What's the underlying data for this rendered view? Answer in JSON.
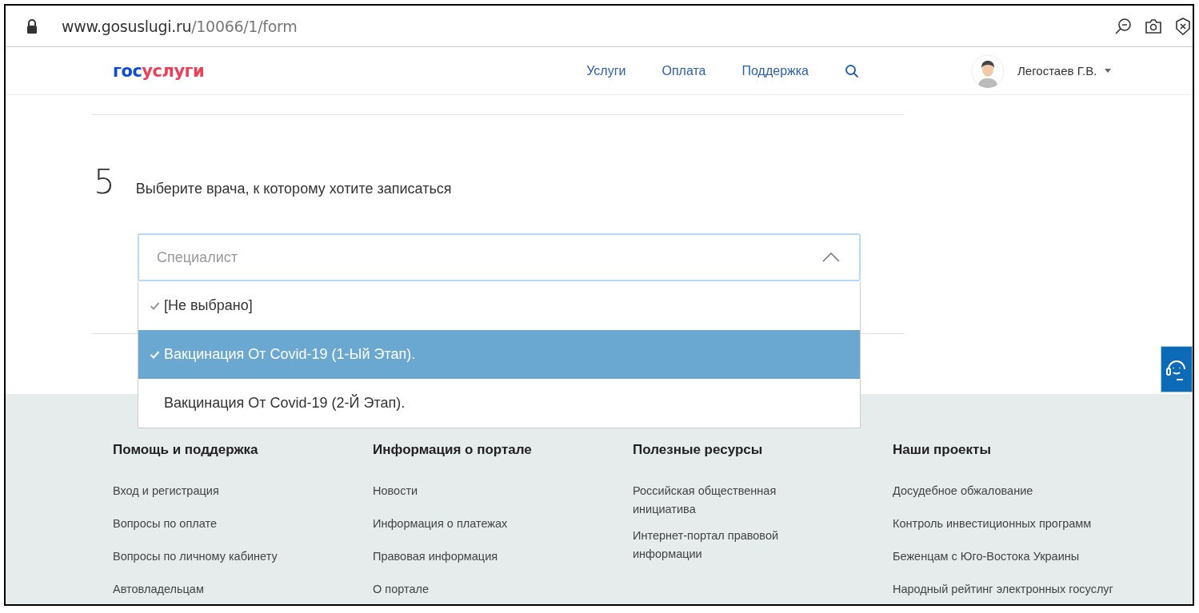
{
  "browser": {
    "url_host": "www.gosuslugi.ru",
    "url_path": "/10066/1/form"
  },
  "header": {
    "logo_part_1": "гос",
    "logo_part_2": "услуги",
    "nav": [
      "Услуги",
      "Оплата",
      "Поддержка"
    ],
    "user": "Легостаев Г.В."
  },
  "step": {
    "number": "5",
    "question": "Выберите врача, к которому хотите записаться"
  },
  "select": {
    "placeholder": "Специалист",
    "expanded": true,
    "options": [
      {
        "label": "[Не выбрано]",
        "checked": true,
        "selected": false
      },
      {
        "label": "Вакцинация От Covid-19 (1-Ый Этап).",
        "checked": true,
        "selected": true
      },
      {
        "label": "Вакцинация От Covid-19 (2-Й Этап).",
        "checked": false,
        "selected": false
      }
    ]
  },
  "footer": {
    "columns": [
      {
        "title": "Помощь и поддержка",
        "links": [
          "Вход и регистрация",
          "Вопросы по оплате",
          "Вопросы по личному кабинету",
          "Автовладельцам"
        ]
      },
      {
        "title": "Информация о портале",
        "links": [
          "Новости",
          "Информация о платежах",
          "Правовая информация",
          "О портале"
        ]
      },
      {
        "title": "Полезные ресурсы",
        "links": [
          "Российская общественная инициатива",
          "Интернет-портал правовой информации"
        ]
      },
      {
        "title": "Наши проекты",
        "links": [
          "Досудебное обжалование",
          "Контроль инвестиционных программ",
          "Беженцам с Юго-Востока Украины",
          "Народный рейтинг электронных госуслуг"
        ]
      }
    ]
  }
}
